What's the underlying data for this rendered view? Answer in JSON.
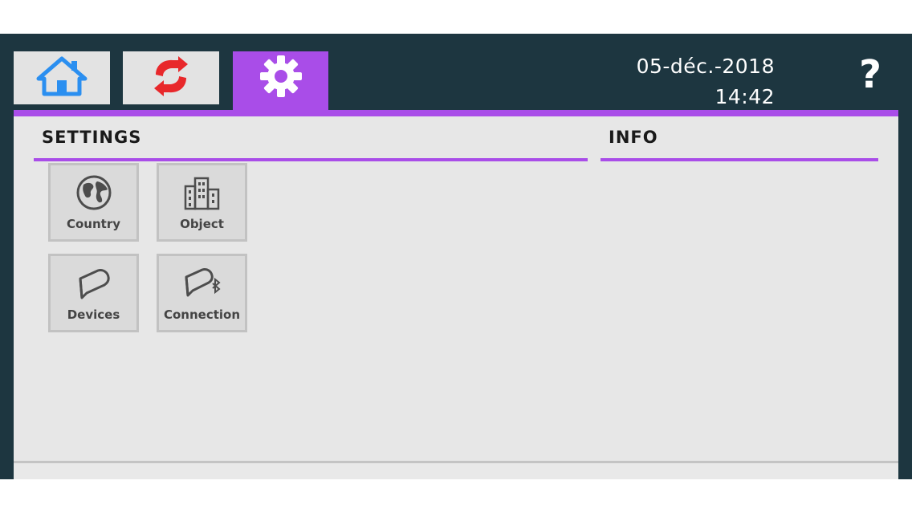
{
  "header": {
    "tabs": [
      {
        "name": "home",
        "icon": "home-icon",
        "color": "#2b8ff0"
      },
      {
        "name": "sync",
        "icon": "sync-arrows-icon",
        "color": "#e8282b"
      },
      {
        "name": "settings",
        "icon": "gear-icon",
        "color": "#ffffff",
        "active": true
      }
    ],
    "date": "05-déc.-2018",
    "time": "14:42",
    "help_label": "?"
  },
  "colors": {
    "accent": "#a94de8",
    "frame": "#1d3640",
    "panel": "#e7e7e7"
  },
  "settings": {
    "title": "SETTINGS",
    "tiles": [
      {
        "label": "Country",
        "icon": "globe-icon"
      },
      {
        "label": "Object",
        "icon": "buildings-icon"
      },
      {
        "label": "Devices",
        "icon": "device-tag-icon"
      },
      {
        "label": "Connection",
        "icon": "bluetooth-device-icon"
      }
    ]
  },
  "info": {
    "title": "INFO"
  }
}
